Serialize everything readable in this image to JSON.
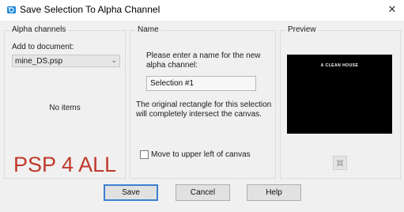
{
  "window": {
    "title": "Save Selection To Alpha Channel",
    "icon": "psp-app-icon",
    "close": "close-icon"
  },
  "alpha_channels": {
    "group_label": "Alpha channels",
    "add_to_document_label": "Add to document:",
    "document_value": "mine_DS.psp",
    "empty_text": "No items"
  },
  "name": {
    "group_label": "Name",
    "prompt": "Please enter a name for the new alpha channel:",
    "input_value": "Selection #1",
    "note": "The original rectangle for this selection will completely intersect the canvas.",
    "checkbox_label": "Move to upper left of canvas",
    "checkbox_checked": false
  },
  "preview": {
    "group_label": "Preview",
    "image_text": "A CLEAN HOUSE",
    "button_icon": "collapse-icon"
  },
  "watermark": "PSP 4 ALL",
  "buttons": {
    "save": "Save",
    "cancel": "Cancel",
    "help": "Help"
  },
  "colors": {
    "accent": "#3c7fd1",
    "watermark": "#c0392b",
    "preview_bg": "#000000"
  }
}
